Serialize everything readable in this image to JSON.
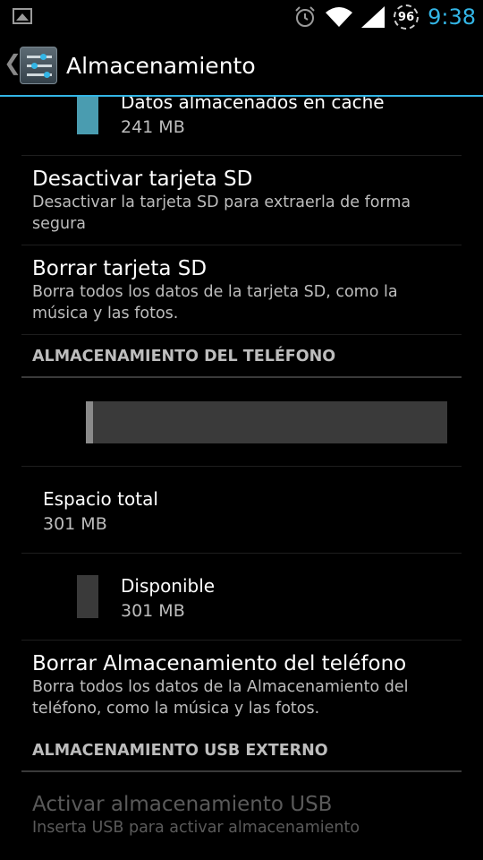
{
  "status_bar": {
    "battery_level": "96",
    "time": "9:38",
    "icons": [
      "image-notification-icon",
      "alarm-icon",
      "wifi-icon",
      "signal-icon",
      "battery-icon"
    ]
  },
  "action_bar": {
    "title": "Almacenamiento",
    "back_icon": "chevron-left-icon",
    "app_icon": "settings-sliders-icon"
  },
  "sd_card": {
    "cache": {
      "label": "Datos almacenados en caché",
      "value": "241 MB",
      "color": "#4a9cb0"
    },
    "unmount": {
      "title": "Desactivar tarjeta SD",
      "summary": "Desactivar la tarjeta SD para extraerla de forma segura"
    },
    "erase": {
      "title": "Borrar tarjeta SD",
      "summary": "Borra todos los datos de la tarjeta SD, como la música y las fotos."
    }
  },
  "phone_storage": {
    "header": "ALMACENAMIENTO DEL TELÉFONO",
    "usage_bar": {
      "used_fraction": 0.02,
      "used_color": "#8a8a8a",
      "free_color": "#3a3a3a"
    },
    "total": {
      "label": "Espacio total",
      "value": "301 MB"
    },
    "available": {
      "label": "Disponible",
      "value": "301 MB",
      "color": "#3a3a3a"
    },
    "erase": {
      "title": "Borrar Almacenamiento del teléfono",
      "summary": "Borra todos los datos de la Almacenamiento del teléfono, como la música y las fotos."
    }
  },
  "usb_storage": {
    "header": "ALMACENAMIENTO USB EXTERNO",
    "mount": {
      "title": "Activar almacenamiento USB",
      "summary": "Inserta USB para activar almacenamiento",
      "enabled": false
    }
  }
}
